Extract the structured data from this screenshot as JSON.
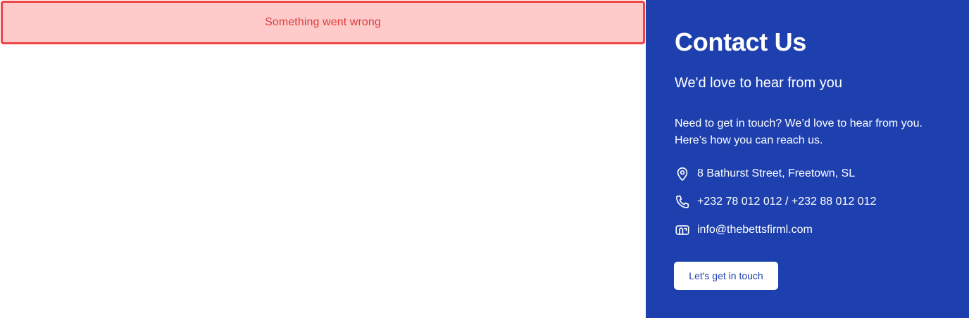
{
  "error_banner": {
    "message": "Something went wrong"
  },
  "contact": {
    "title": "Contact Us",
    "subtitle": "We'd love to hear from you",
    "description": "Need to get in touch? We’d love to hear from you. Here’s how you can reach us.",
    "address": "8 Bathurst Street, Freetown, SL",
    "phone": "+232 78 012 012 / +232 88 012 012",
    "email": "info@thebettsfirml.com",
    "cta_label": "Let's get in touch",
    "icons": {
      "address": "map-pin-icon",
      "phone": "phone-icon",
      "email": "mailbox-icon"
    }
  },
  "colors": {
    "panel_bg": "#1e40af",
    "error_bg": "#fecaca",
    "error_border": "#ef4444",
    "error_text": "#dc3d3d",
    "button_bg": "#ffffff"
  }
}
